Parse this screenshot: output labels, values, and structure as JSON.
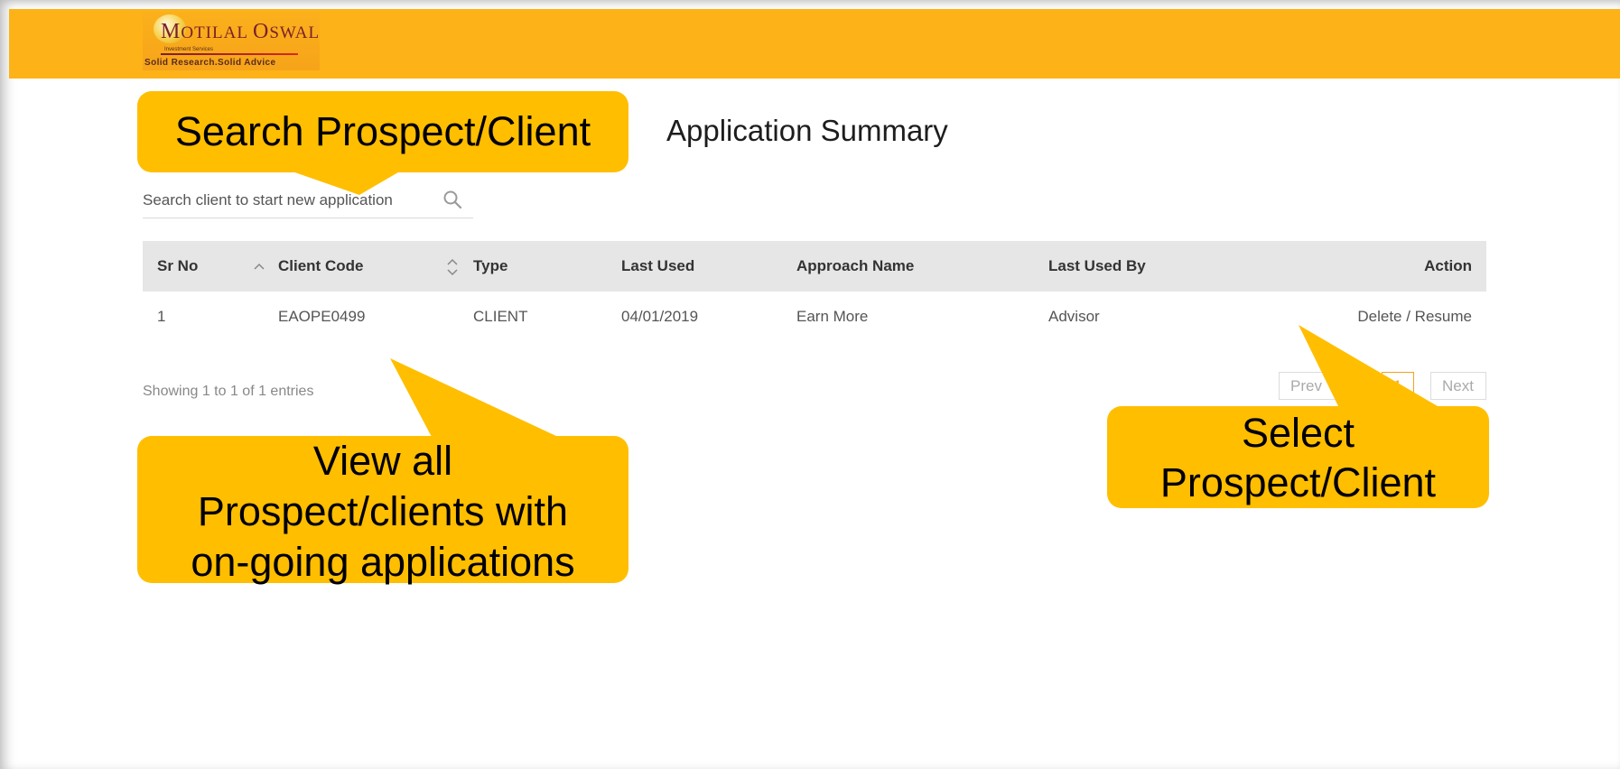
{
  "header": {
    "logo": {
      "brand": "Motilal Oswal",
      "sub": "Investment Services",
      "tagline": "Solid Research.Solid Advice"
    }
  },
  "page_title": "Application Summary",
  "search": {
    "placeholder": "Search client to start new application",
    "icon": "search-icon"
  },
  "table": {
    "columns": [
      "Sr No",
      "Client Code",
      "Type",
      "Last Used",
      "Approach Name",
      "Last Used By",
      "Action"
    ],
    "rows": [
      {
        "sr_no": "1",
        "client_code": "EAOPE0499",
        "type": "CLIENT",
        "last_used": "04/01/2019",
        "approach_name": "Earn More",
        "last_used_by": "Advisor",
        "action": "Delete / Resume"
      }
    ]
  },
  "footer": {
    "showing": "Showing 1 to 1 of 1 entries",
    "prev": "Prev",
    "page": "1",
    "next": "Next"
  },
  "callouts": {
    "search": "Search Prospect/Client",
    "view_line1": "View all",
    "view_line2": "Prospect/clients with",
    "view_line3": "on-going applications",
    "select_line1": "Select",
    "select_line2": "Prospect/Client"
  },
  "colors": {
    "header": "#fdb218",
    "callout": "#ffbe00",
    "table_header": "#e6e6e6",
    "page_active": "#f3a21b"
  }
}
